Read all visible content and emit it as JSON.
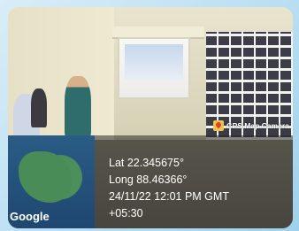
{
  "overlay": {
    "brand": "GPS Map Camera",
    "map_logo": "Google",
    "lat": "Lat 22.345675°",
    "long": "Long 88.46366°",
    "datetime": "24/11/22 12:01 PM GMT",
    "timezone": "+05:30"
  },
  "icons": {
    "gps_badge": "gps-map-camera-icon"
  }
}
